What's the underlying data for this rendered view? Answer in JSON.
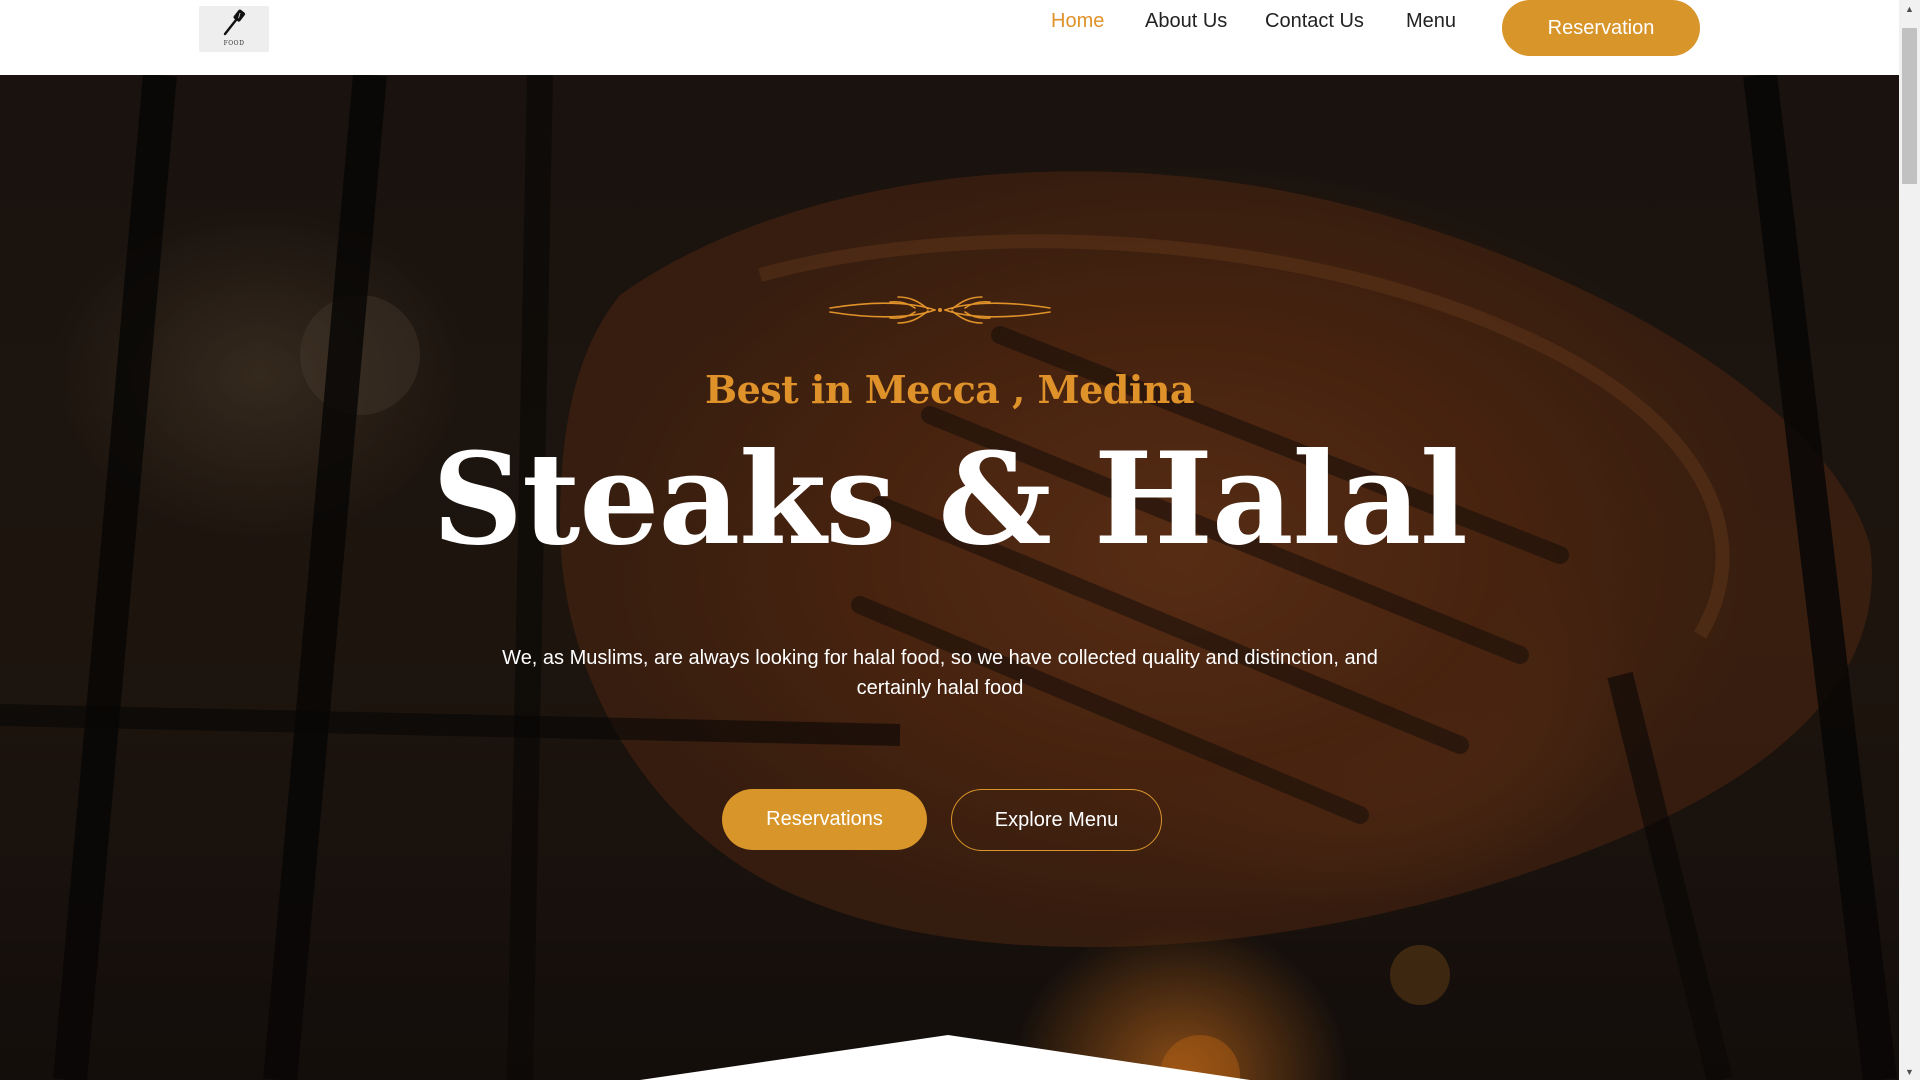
{
  "brand": {
    "logo_text": "FOOD",
    "logo_icon": "spatula-icon"
  },
  "nav": {
    "items": [
      {
        "label": "Home",
        "active": true
      },
      {
        "label": "About Us",
        "active": false
      },
      {
        "label": "Contact Us",
        "active": false
      },
      {
        "label": "Menu",
        "active": false
      }
    ],
    "cta_label": "Reservation"
  },
  "hero": {
    "ornament_icon": "wheat-divider-icon",
    "kicker": "Best in Mecca , Medina",
    "title": "Steaks & Halal",
    "description": "We, as Muslims, are always looking for halal food, so we have collected quality and distinction, and certainly halal food",
    "primary_button": "Reservations",
    "secondary_button": "Explore Menu"
  },
  "scrollbar": {
    "up_icon": "scroll-up-arrow-icon",
    "down_icon": "scroll-down-arrow-icon",
    "position": 0.0
  },
  "colors": {
    "accent": "#d8952a",
    "nav_active": "#e0922a",
    "header_bg": "#ffffff",
    "hero_text": "#ffffff"
  }
}
